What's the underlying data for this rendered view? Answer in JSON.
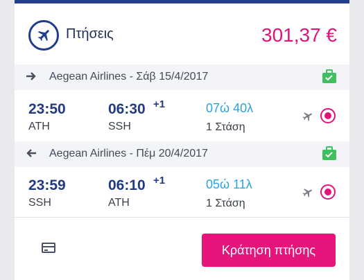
{
  "header": {
    "title": "Πτήσεις",
    "price": "301,37 €"
  },
  "segments": [
    {
      "direction": "outbound",
      "airline_date": "Aegean Airlines - Σάβ 15/4/2017",
      "depart_time": "23:50",
      "depart_airport": "ATH",
      "arrive_time": "06:30",
      "day_offset": "+1",
      "arrive_airport": "SSH",
      "duration": "07ώ 40λ",
      "stops": "1 Στάση"
    },
    {
      "direction": "return",
      "airline_date": "Aegean Airlines - Πέμ 20/4/2017",
      "depart_time": "23:59",
      "depart_airport": "SSH",
      "arrive_time": "06:10",
      "day_offset": "+1",
      "arrive_airport": "ATH",
      "duration": "05ώ 11λ",
      "stops": "1 Στάση"
    }
  ],
  "footer": {
    "book_label": "Κράτηση πτήσης"
  },
  "colors": {
    "accent": "#e2127b",
    "primary": "#213a80",
    "duration": "#2aa3dd",
    "baggage": "#3fbf5f"
  },
  "icons": {
    "header": "airplane-icon",
    "outbound": "arrow-right-icon",
    "return": "arrow-left-icon",
    "baggage": "baggage-icon",
    "payment": "credit-card-icon"
  }
}
